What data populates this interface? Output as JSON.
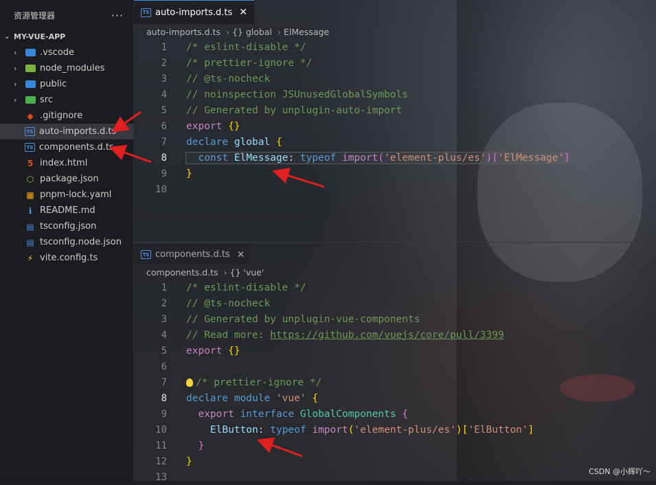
{
  "sidebar": {
    "title": "资源管理器",
    "more_icon": "ellipsis-icon",
    "project": "MY-VUE-APP",
    "items": [
      {
        "label": ".vscode",
        "type": "folder",
        "icon_color": "#3a86d6"
      },
      {
        "label": "node_modules",
        "type": "folder",
        "icon_color": "#7cb342"
      },
      {
        "label": "public",
        "type": "folder",
        "icon_color": "#3a86d6"
      },
      {
        "label": "src",
        "type": "folder",
        "icon_color": "#4caf50"
      },
      {
        "label": ".gitignore",
        "type": "file",
        "icon": "git-icon",
        "icon_color": "#e64a19"
      },
      {
        "label": "auto-imports.d.ts",
        "type": "file",
        "icon": "ts-icon",
        "selected": true
      },
      {
        "label": "components.d.ts",
        "type": "file",
        "icon": "ts-icon"
      },
      {
        "label": "index.html",
        "type": "file",
        "icon": "html-icon",
        "icon_color": "#e44d26"
      },
      {
        "label": "package.json",
        "type": "file",
        "icon": "nodejs-icon",
        "icon_color": "#8bc34a"
      },
      {
        "label": "pnpm-lock.yaml",
        "type": "file",
        "icon": "pnpm-icon",
        "icon_color": "#f9ad00"
      },
      {
        "label": "README.md",
        "type": "file",
        "icon": "info-icon",
        "icon_color": "#42a5f5"
      },
      {
        "label": "tsconfig.json",
        "type": "file",
        "icon": "tsconfig-icon",
        "icon_color": "#4b91e3"
      },
      {
        "label": "tsconfig.node.json",
        "type": "file",
        "icon": "tsconfig-icon",
        "icon_color": "#4b91e3"
      },
      {
        "label": "vite.config.ts",
        "type": "file",
        "icon": "vite-icon",
        "icon_color": "#ffca28"
      }
    ]
  },
  "editor_top": {
    "tab": "auto-imports.d.ts",
    "ts_icon": "TS",
    "breadcrumb": [
      "auto-imports.d.ts",
      "{} global",
      "ElMessage"
    ],
    "lines": [
      "1",
      "2",
      "3",
      "4",
      "5",
      "6",
      "7",
      "8",
      "9",
      "10"
    ],
    "current_line": "8",
    "code": [
      [
        [
          "c-comment",
          "/* eslint-disable */"
        ]
      ],
      [
        [
          "c-comment",
          "/* prettier-ignore */"
        ]
      ],
      [
        [
          "c-comment",
          "// @ts-nocheck"
        ]
      ],
      [
        [
          "c-comment",
          "// noinspection JSUnusedGlobalSymbols"
        ]
      ],
      [
        [
          "c-comment",
          "// Generated by unplugin-auto-import"
        ]
      ],
      [
        [
          "c-kw2",
          "export "
        ],
        [
          "c-brace",
          "{}"
        ]
      ],
      [
        [
          "c-kw",
          "declare "
        ],
        [
          "c-var",
          "global "
        ],
        [
          "c-brace",
          "{"
        ]
      ],
      [
        [
          "c-punc",
          "  "
        ],
        [
          "c-kw",
          "const "
        ],
        [
          "c-var",
          "ElMessage"
        ],
        [
          "c-punc",
          ": "
        ],
        [
          "c-kw",
          "typeof "
        ],
        [
          "c-kw2",
          "import"
        ],
        [
          "c-brace2",
          "("
        ],
        [
          "c-str",
          "'element-plus/es'"
        ],
        [
          "c-brace2",
          ")"
        ],
        [
          "c-brace2",
          "["
        ],
        [
          "c-str",
          "'ElMessage'"
        ],
        [
          "c-brace2",
          "]"
        ]
      ],
      [
        [
          "c-brace",
          "}"
        ]
      ],
      []
    ]
  },
  "editor_bottom": {
    "tab": "components.d.ts",
    "ts_icon": "TS",
    "breadcrumb": [
      "components.d.ts",
      "{} 'vue'"
    ],
    "lines": [
      "1",
      "2",
      "3",
      "4",
      "5",
      "6",
      "7",
      "8",
      "9",
      "10",
      "11",
      "12",
      "13"
    ],
    "current_line": "8",
    "code": [
      [
        [
          "c-comment",
          "/* eslint-disable */"
        ]
      ],
      [
        [
          "c-comment",
          "// @ts-nocheck"
        ]
      ],
      [
        [
          "c-comment",
          "// Generated by unplugin-vue-components"
        ]
      ],
      [
        [
          "c-comment",
          "// Read more: "
        ],
        [
          "c-link",
          "https://github.com/vuejs/core/pull/3399"
        ]
      ],
      [
        [
          "c-kw2",
          "export "
        ],
        [
          "c-brace",
          "{}"
        ]
      ],
      [],
      [
        [
          "c-comment",
          "/* prettier-ignore */"
        ]
      ],
      [
        [
          "c-kw",
          "declare "
        ],
        [
          "c-kw",
          "module "
        ],
        [
          "c-str",
          "'vue' "
        ],
        [
          "c-brace",
          "{"
        ]
      ],
      [
        [
          "c-punc",
          "  "
        ],
        [
          "c-kw2",
          "export "
        ],
        [
          "c-kw",
          "interface "
        ],
        [
          "c-type",
          "GlobalComponents "
        ],
        [
          "c-brace2",
          "{"
        ]
      ],
      [
        [
          "c-punc",
          "    "
        ],
        [
          "c-var",
          "ElButton"
        ],
        [
          "c-punc",
          ": "
        ],
        [
          "c-kw",
          "typeof "
        ],
        [
          "c-kw2",
          "import"
        ],
        [
          "c-brace",
          "("
        ],
        [
          "c-str",
          "'element-plus/es'"
        ],
        [
          "c-brace",
          ")"
        ],
        [
          "c-brace",
          "["
        ],
        [
          "c-str",
          "'ElButton'"
        ],
        [
          "c-brace",
          "]"
        ]
      ],
      [
        [
          "c-punc",
          "  "
        ],
        [
          "c-brace2",
          "}"
        ]
      ],
      [
        [
          "c-brace",
          "}"
        ]
      ],
      []
    ]
  },
  "watermark": "CSDN @小辉吖～",
  "colors": {
    "accent": "#3c8fd9",
    "annotation_arrow": "#e02020"
  }
}
